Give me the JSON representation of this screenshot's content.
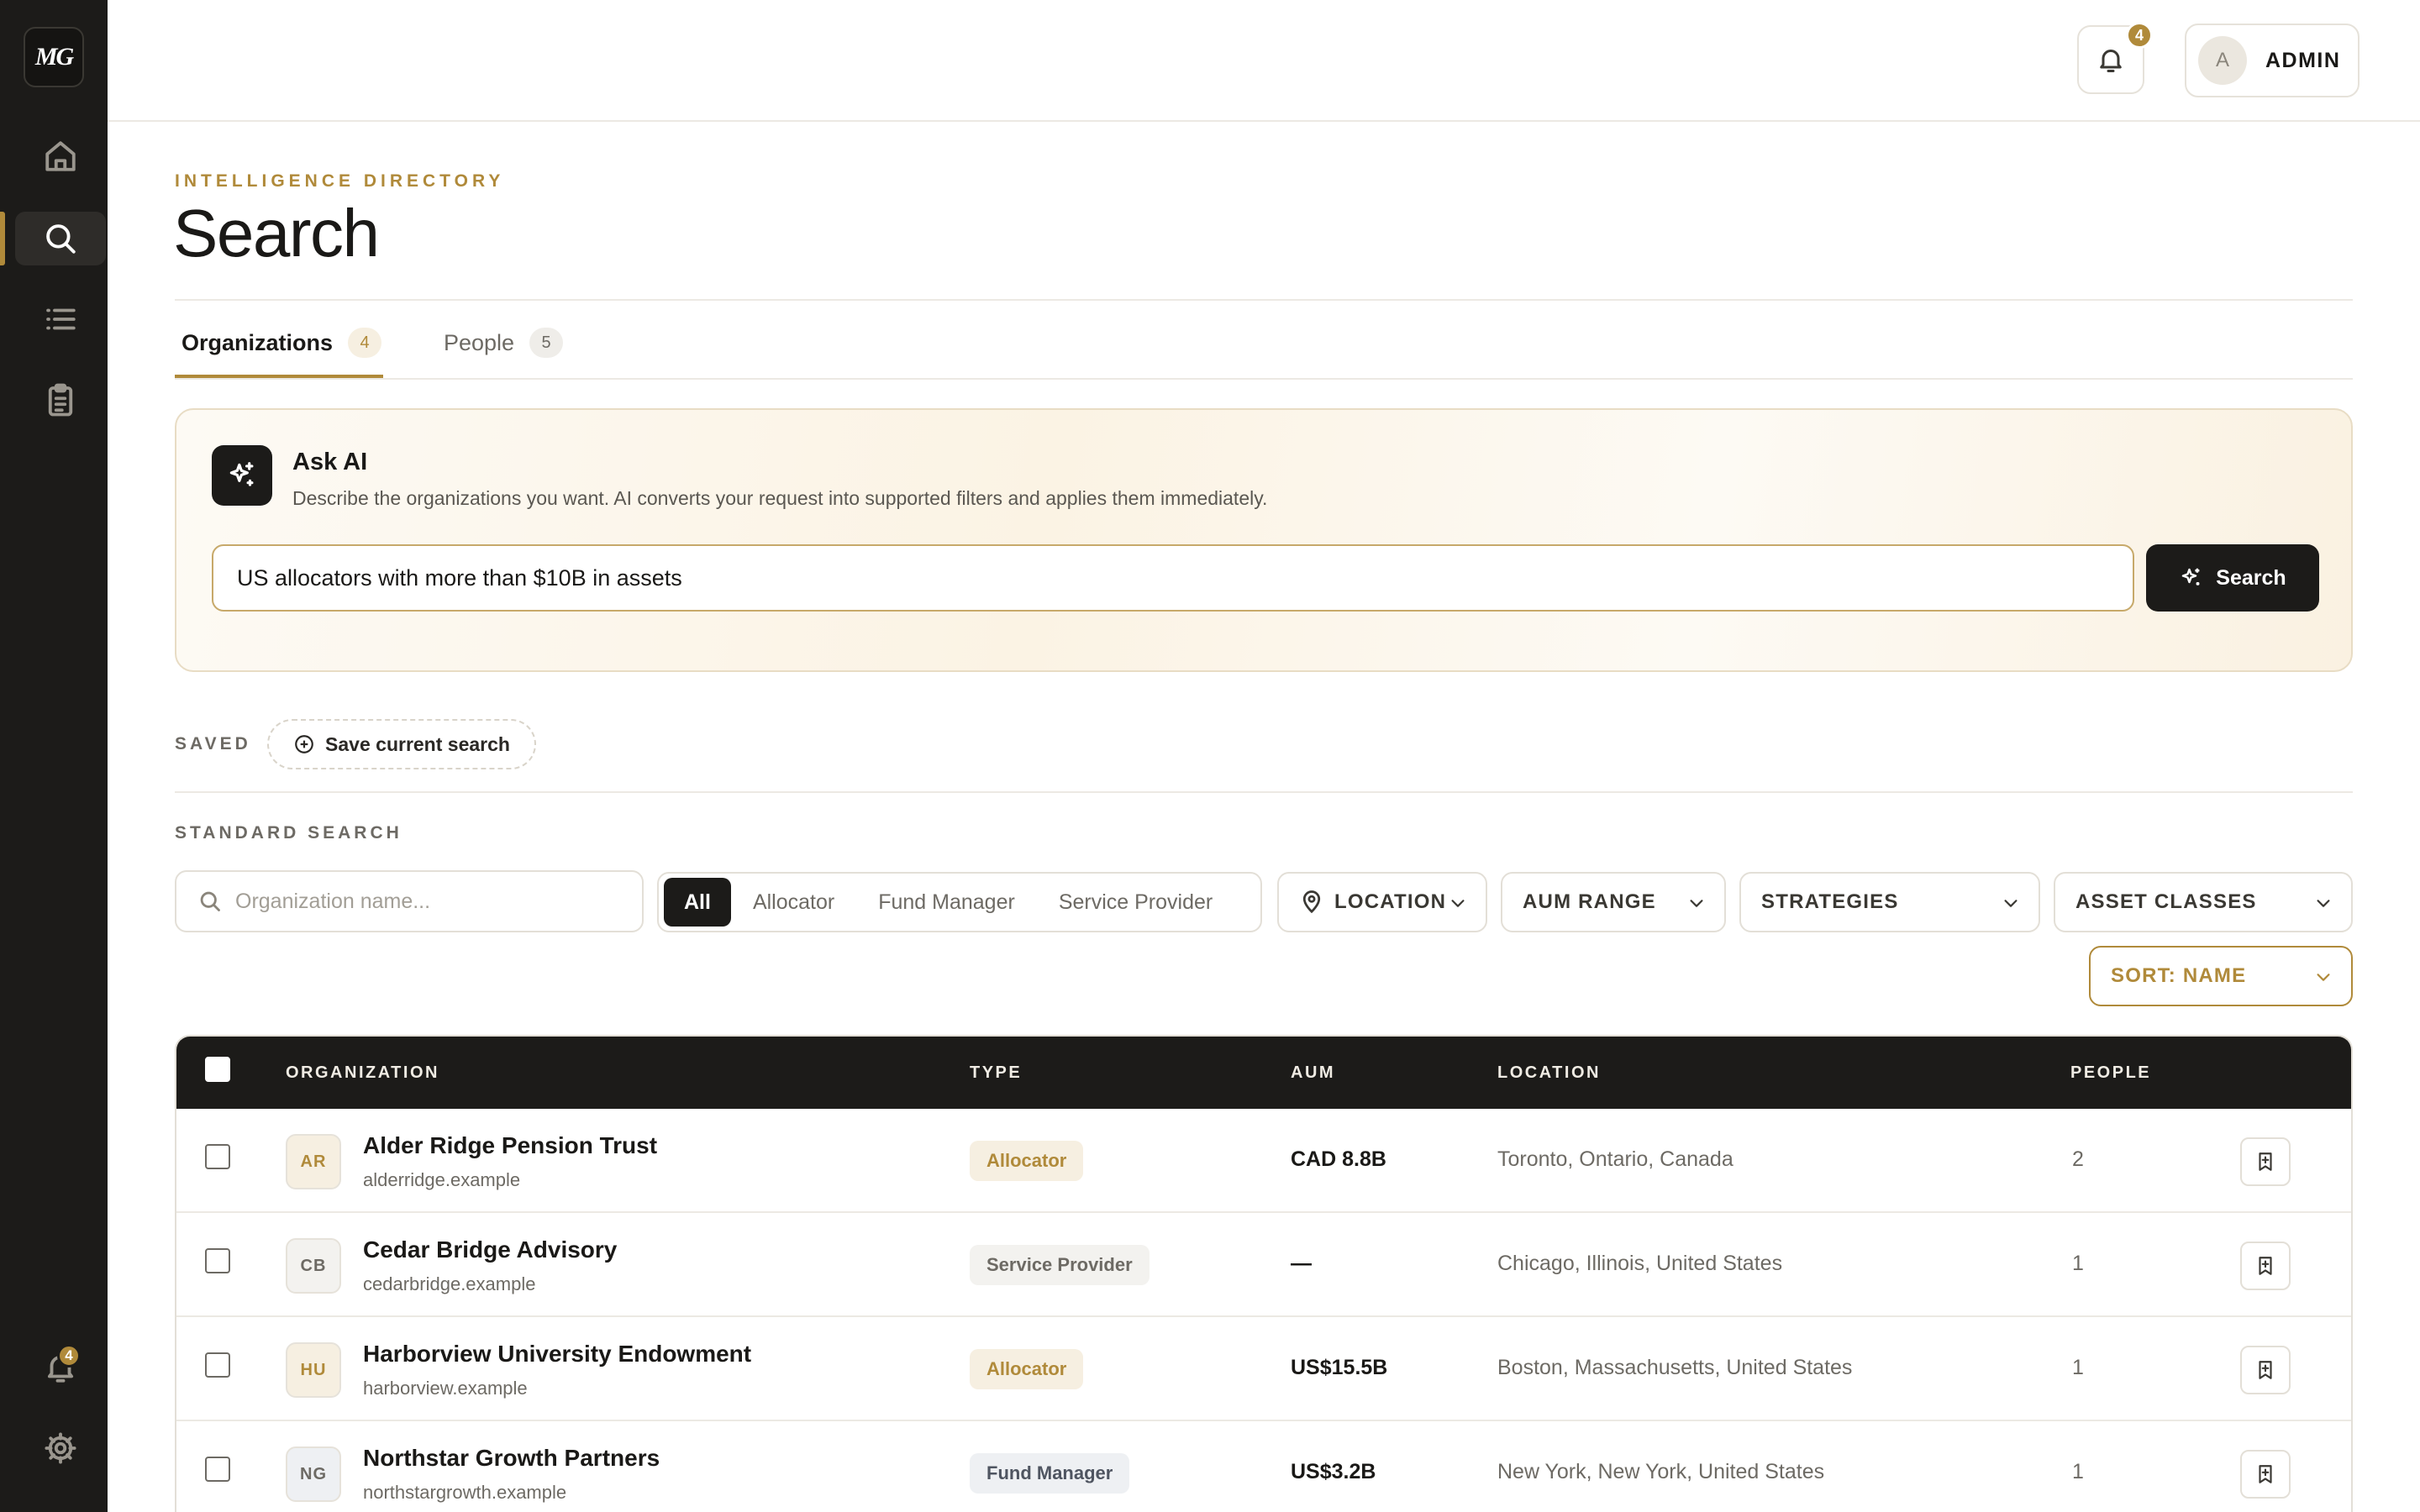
{
  "brand": {
    "logo_text": "MG"
  },
  "sidebar": {
    "items": [
      {
        "name": "home"
      },
      {
        "name": "search",
        "active": true
      },
      {
        "name": "lists"
      },
      {
        "name": "tasks"
      }
    ],
    "notifications_badge": "4"
  },
  "topbar": {
    "notifications_badge": "4",
    "avatar_initial": "A",
    "user_label": "ADMIN"
  },
  "header": {
    "eyebrow": "INTELLIGENCE DIRECTORY",
    "title": "Search"
  },
  "tabs": [
    {
      "label": "Organizations",
      "count": "4",
      "active": true
    },
    {
      "label": "People",
      "count": "5",
      "active": false
    }
  ],
  "ask_ai": {
    "title": "Ask AI",
    "description": "Describe the organizations you want. AI converts your request into supported filters and applies them immediately.",
    "query": "US allocators with more than $10B in assets",
    "button_label": "Search"
  },
  "saved": {
    "label": "SAVED",
    "save_button": "Save current search"
  },
  "standard_search": {
    "label": "STANDARD SEARCH",
    "name_placeholder": "Organization name...",
    "type_segments": [
      "All",
      "Allocator",
      "Fund Manager",
      "Service Provider"
    ],
    "active_segment": "All",
    "location": "LOCATION",
    "aum_range": "AUM RANGE",
    "strategies": "STRATEGIES",
    "asset_classes": "ASSET CLASSES",
    "sort": "SORT: NAME"
  },
  "table": {
    "columns": [
      "ORGANIZATION",
      "TYPE",
      "AUM",
      "LOCATION",
      "PEOPLE"
    ],
    "rows": [
      {
        "initials": "AR",
        "name": "Alder Ridge Pension Trust",
        "domain": "alderridge.example",
        "type": "Allocator",
        "aum": "CAD 8.8B",
        "location": "Toronto, Ontario, Canada",
        "people": "2"
      },
      {
        "initials": "CB",
        "name": "Cedar Bridge Advisory",
        "domain": "cedarbridge.example",
        "type": "Service Provider",
        "aum": "—",
        "location": "Chicago, Illinois, United States",
        "people": "1"
      },
      {
        "initials": "HU",
        "name": "Harborview University Endowment",
        "domain": "harborview.example",
        "type": "Allocator",
        "aum": "US$15.5B",
        "location": "Boston, Massachusetts, United States",
        "people": "1"
      },
      {
        "initials": "NG",
        "name": "Northstar Growth Partners",
        "domain": "northstargrowth.example",
        "type": "Fund Manager",
        "aum": "US$3.2B",
        "location": "New York, New York, United States",
        "people": "1"
      }
    ]
  },
  "colors": {
    "accent": "#b08a3a",
    "sidebar_bg": "#1c1b19",
    "table_header_bg": "#1c1b19"
  }
}
